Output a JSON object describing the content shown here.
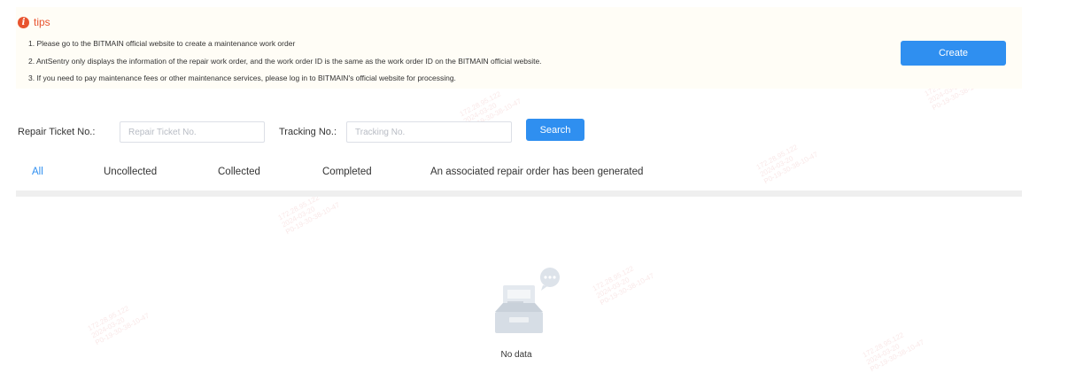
{
  "tips": {
    "title": "tips",
    "lines": [
      "1. Please go to the BITMAIN official website to create a maintenance work order",
      "2. AntSentry only displays the information of the repair work order, and the work order ID is the same as the work order ID on the BITMAIN official website.",
      "3. If you need to pay maintenance fees or other maintenance services, please log in to BITMAIN's official website for processing."
    ]
  },
  "create_label": "Create",
  "filters": {
    "repair_ticket_label": "Repair Ticket No.:",
    "repair_ticket_placeholder": "Repair Ticket No.",
    "tracking_label": "Tracking No.:",
    "tracking_placeholder": "Tracking No.",
    "search_label": "Search"
  },
  "tabs": [
    {
      "label": "All",
      "active": true
    },
    {
      "label": "Uncollected",
      "active": false
    },
    {
      "label": "Collected",
      "active": false
    },
    {
      "label": "Completed",
      "active": false
    },
    {
      "label": "An associated repair order has been generated",
      "active": false
    }
  ],
  "empty": {
    "text": "No data"
  },
  "watermark": "172.28.95.122\n2024-03-20\nP0-19-30-38-10-47",
  "colors": {
    "primary": "#2f8ff0",
    "tips": "#e8542f"
  }
}
